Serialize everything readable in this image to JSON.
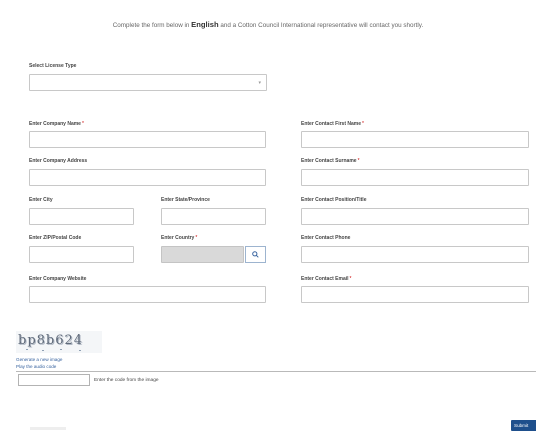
{
  "intro": {
    "before": "Complete the form below in",
    "bold": "English",
    "after": "and a Cotton Council International representative will contact you shortly."
  },
  "form": {
    "license_label": "Select License Type",
    "license_value": "",
    "company_name_label": "Enter Company Name",
    "company_address_label": "Enter Company Address",
    "city_label": "Enter City",
    "state_label": "Enter State/Province",
    "zip_label": "Enter ZIP/Postal Code",
    "country_label": "Enter Country",
    "website_label": "Enter Company Website",
    "first_name_label": "Enter Contact First Name",
    "surname_label": "Enter Contact Surname",
    "position_label": "Enter Contact Position/Title",
    "phone_label": "Enter Contact Phone",
    "email_label": "Enter Contact Email",
    "required_mark": "*"
  },
  "captcha": {
    "code": "bp8b624",
    "new_image_link": "Generate a new image",
    "audio_link": "Play the audio code",
    "input_label": "Enter the code from the image"
  },
  "submit_label": "Submit",
  "colors": {
    "link": "#35619e",
    "button": "#1e4f8c",
    "required": "#cc0000"
  }
}
